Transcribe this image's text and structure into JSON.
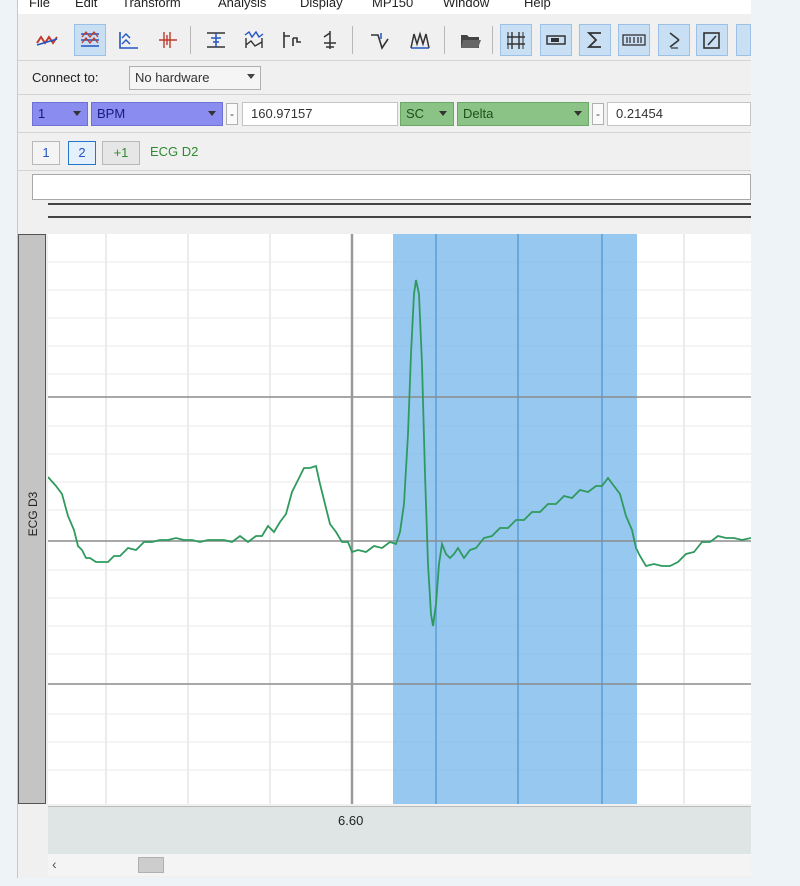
{
  "menu": [
    "File",
    "Edit",
    "Transform",
    "Analysis",
    "Display",
    "MP150",
    "Window",
    "Help"
  ],
  "toolbar": {
    "icons": [
      "waveform-tool-icon",
      "overlap-segments-icon",
      "stack-segments-icon",
      "ruler-icon",
      "align-icon",
      "autoscale-waveform-icon",
      "zoom-horizontal-icon",
      "marker-icon",
      "peak-detect-icon",
      "find-cycle-icon",
      "open-folder-icon",
      "grid-icon",
      "horizontal-scroll-icon",
      "sum-icon",
      "data-view-icon",
      "tool-arrow-icon",
      "edit-graph-icon"
    ],
    "icon_colors": {
      "tool": "#c0392b",
      "accent": "#2255c4",
      "dark": "#333333"
    }
  },
  "connect": {
    "label": "Connect to:",
    "value": "No hardware"
  },
  "measurement_1": {
    "channel": "1",
    "type": "BPM",
    "dash": "-",
    "value": "160.97157",
    "color": "#8a8cf0"
  },
  "measurement_2": {
    "channel": "SC",
    "type": "Delta",
    "dash": "-",
    "value": "0.21454",
    "color": "#8bc285"
  },
  "channels": {
    "button_1": "1",
    "button_2": "2",
    "button_plus": "+1",
    "label": "ECG D2",
    "label_color": "#2e8b2e"
  },
  "plot": {
    "channel_label": "ECG D3",
    "time_label": "6.60",
    "trace_color": "#2f9a5e",
    "selection_color": "#7ab8ec"
  }
}
